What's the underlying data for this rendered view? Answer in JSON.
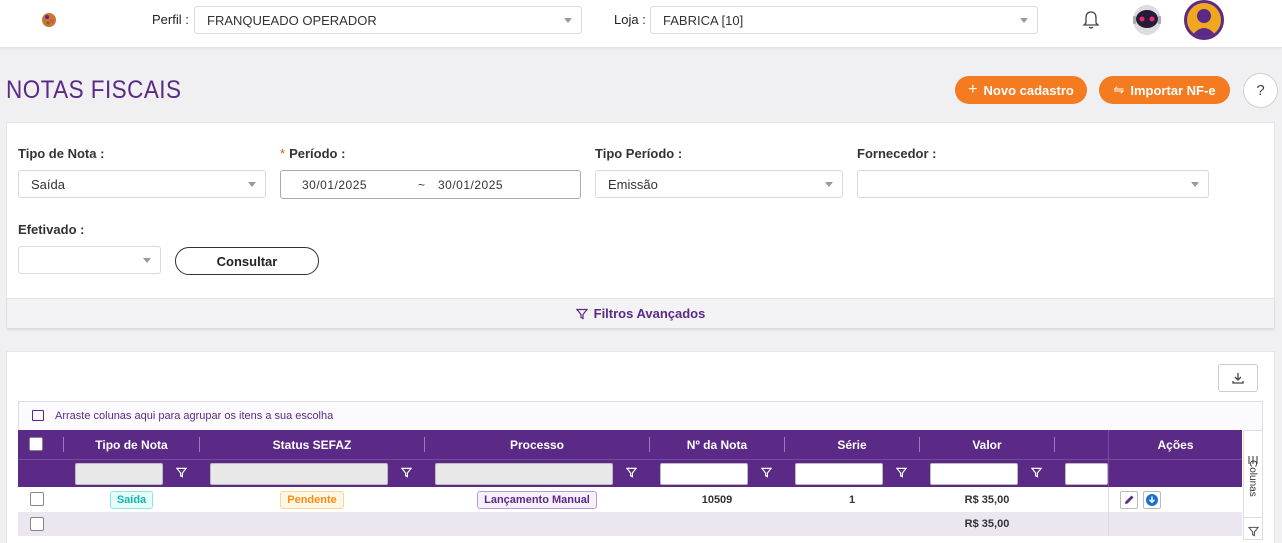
{
  "topbar": {
    "profile_label": "Perfil :",
    "profile_value": "FRANQUEADO OPERADOR",
    "store_label": "Loja :",
    "store_value": "FABRICA [10]"
  },
  "page": {
    "title": "NOTAS FISCAIS",
    "new_button": "Novo cadastro",
    "import_button": "Importar NF-e",
    "help": "?"
  },
  "filters": {
    "tipo_nota_label": "Tipo de Nota :",
    "tipo_nota_value": "Saída",
    "periodo_label": "Período :",
    "periodo_start": "30/01/2025",
    "periodo_sep": "~",
    "periodo_end": "30/01/2025",
    "tipo_periodo_label": "Tipo Período :",
    "tipo_periodo_value": "Emissão",
    "fornecedor_label": "Fornecedor :",
    "fornecedor_value": "",
    "efetivado_label": "Efetivado :",
    "efetivado_value": "",
    "consultar": "Consultar",
    "advanced": "Filtros Avançados"
  },
  "grid": {
    "group_hint": "Arraste colunas aqui para agrupar os itens a sua escolha",
    "columns": [
      "Tipo de Nota",
      "Status SEFAZ",
      "Processo",
      "Nº da Nota",
      "Série",
      "Valor"
    ],
    "actions_header": "Ações",
    "side_panel": "Colunas",
    "rows": [
      {
        "tipo": "Saída",
        "status": "Pendente",
        "processo": "Lançamento Manual",
        "numero": "10509",
        "serie": "1",
        "valor": "R$ 35,00"
      }
    ],
    "total_valor": "R$ 35,00"
  },
  "colors": {
    "primary": "#5b2a86",
    "accent": "#f47b20"
  }
}
